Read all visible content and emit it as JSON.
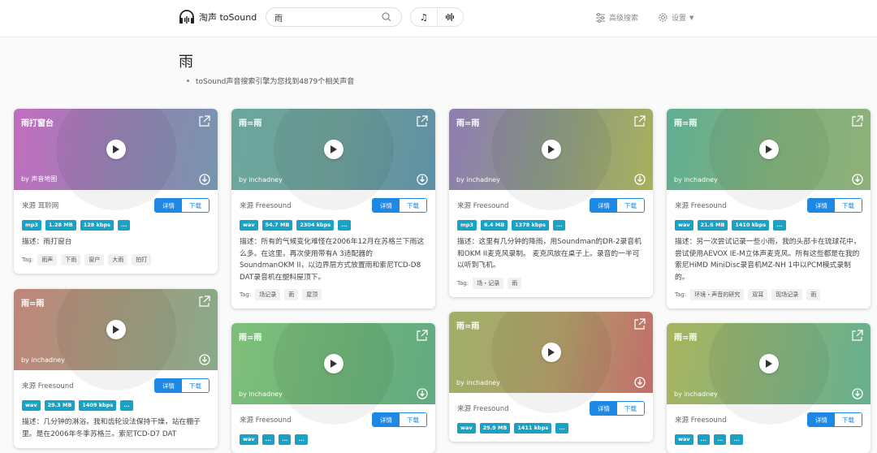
{
  "header": {
    "logo_text": "淘声 toSound",
    "search_value": "雨",
    "mode_music_icon": "music-note-icon",
    "mode_wave_icon": "waveform-icon",
    "advanced_search": "高级搜索",
    "settings": "设置"
  },
  "query": "雨",
  "result_text": "toSound声音搜索引擎为您找到4879个相关声音",
  "labels": {
    "detail": "详情",
    "download": "下载",
    "tag_prefix": "Tag:"
  },
  "cards": [
    {
      "title": "雨打窗台",
      "author": "by 声音地图",
      "source": "来源 耳聆网",
      "meta": [
        "mp3",
        "1.28 MB",
        "128 kbps",
        "..."
      ],
      "desc": "描述：雨打窗台",
      "tags": [
        "雨声",
        "下雨",
        "窗户",
        "大雨",
        "拍打"
      ],
      "gradient": "linear-gradient(100deg,#c46dc0 0%,#9a7fb4 45%,#7795ad 100%)"
    },
    {
      "title": "雨=雨",
      "author": "by inchadney",
      "source": "来源 Freesound",
      "meta": [
        "wav",
        "54.7 MB",
        "2304 kbps",
        "..."
      ],
      "desc": "描述：所有的气候变化难怪在2006年12月在苏格兰下雨这么多。在这里，再次使用带有A 3适配器的SoundmanOKM II，以边界层方式放置雨和索尼TCD-D8 DAT录音机在塑料屋顶下。",
      "tags": [
        "场记录",
        "雨",
        "屋顶"
      ],
      "gradient": "linear-gradient(100deg,#6ba79d 0%,#6e9f98 50%,#5f8fa5 100%)"
    },
    {
      "title": "雨=雨",
      "author": "by inchadney",
      "source": "来源 Freesound",
      "meta": [
        "mp3",
        "6.4 MB",
        "1378 kbps",
        "..."
      ],
      "desc": "描述：这里有几分钟的降雨，用Soundman的DR-2录音机和OKM II麦克风录制。 麦克风放在桌子上。录音的一半可以听到飞机。",
      "tags": [
        "场・记录",
        "雨"
      ],
      "gradient": "linear-gradient(100deg,#8f7cb3 0%,#8c9a86 50%,#a8b05b 100%)"
    },
    {
      "title": "雨=雨",
      "author": "by inchadney",
      "source": "来源 Freesound",
      "meta": [
        "wav",
        "21.6 MB",
        "1410 kbps",
        "..."
      ],
      "desc": "描述：另一次尝试记录一些小雨，我的头部卡在琉球花中，尝试使用AEVOX IE-M立体声麦克风。所有这些都是在我的索尼HiMD MiniDisc录音机MZ-NH 1中以PCM模式录制的。",
      "tags": [
        "环境・声音的研究",
        "双耳",
        "现场记录",
        "雨"
      ],
      "gradient": "linear-gradient(100deg,#5fae94 0%,#7fb07c 50%,#8fb07a 100%)"
    },
    {
      "title": "雨=雨",
      "author": "by inchadney",
      "source": "来源 Freesound",
      "meta": [
        "wav",
        "29.3 MB",
        "1409 kbps",
        "..."
      ],
      "desc": "描述：几分钟的淋浴。我和齿轮设法保持干燥，站在棚子里。是在2006年冬季苏格兰。索尼TCD-D7 DAT",
      "tags": [],
      "gradient": "linear-gradient(100deg,#c0857a 0%,#a49a7e 50%,#88aa88 100%)"
    },
    {
      "title": "雨=雨",
      "author": "by inchadney",
      "source": "来源 Freesound",
      "meta": [
        "wav",
        "...",
        "...",
        "..."
      ],
      "desc": "",
      "tags": [],
      "gradient": "linear-gradient(100deg,#7fbf7a 0%,#6fb478 50%,#62aa82 100%)"
    },
    {
      "title": "雨=雨",
      "author": "by inchadney",
      "source": "来源 Freesound",
      "meta": [
        "wav",
        "29.9 MB",
        "1411 kbps",
        "..."
      ],
      "desc": "",
      "tags": [],
      "gradient": "linear-gradient(100deg,#9fb06a 0%,#b0a06a 50%,#c26d6a 100%)"
    },
    {
      "title": "雨=雨",
      "author": "by inchadney",
      "source": "来源 Freesound",
      "meta": [
        "wav",
        "...",
        "...",
        "..."
      ],
      "desc": "",
      "tags": [],
      "gradient": "linear-gradient(100deg,#a8b45e 0%,#88b27a 50%,#66b08f 100%)"
    }
  ]
}
